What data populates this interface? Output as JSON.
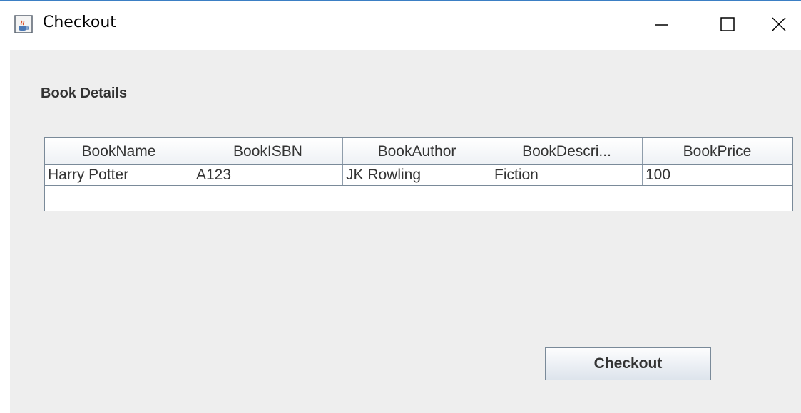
{
  "window": {
    "title": "Checkout",
    "icon": "java-cup-icon",
    "controls": {
      "minimize_icon": "minimize-icon",
      "maximize_icon": "maximize-icon",
      "close_icon": "close-icon"
    }
  },
  "section": {
    "label": "Book Details"
  },
  "table": {
    "columns": [
      "BookName",
      "BookISBN",
      "BookAuthor",
      "BookDescri...",
      "BookPrice"
    ],
    "rows": [
      [
        "Harry Potter",
        "A123",
        "JK Rowling",
        "Fiction",
        "100"
      ]
    ]
  },
  "actions": {
    "checkout_label": "Checkout"
  },
  "colors": {
    "content_background": "#eeeeee",
    "border": "#7a8a99",
    "text": "#333333",
    "titlebar_accent": "#3b7fc4"
  }
}
